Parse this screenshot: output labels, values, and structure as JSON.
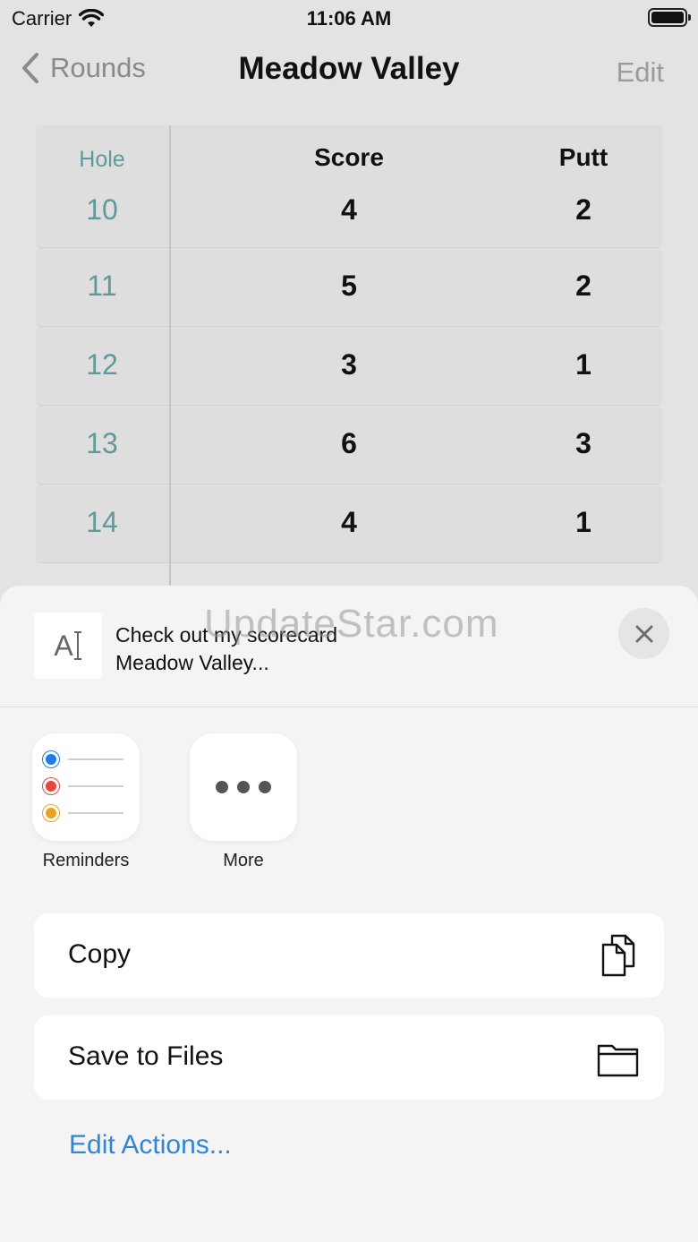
{
  "status_bar": {
    "carrier": "Carrier",
    "time": "11:06 AM"
  },
  "nav": {
    "back_label": "Rounds",
    "title": "Meadow Valley",
    "edit_label": "Edit"
  },
  "table": {
    "headers": {
      "hole": "Hole",
      "score": "Score",
      "putt": "Putt"
    },
    "rows": [
      {
        "hole": "10",
        "score": "4",
        "putt": "2"
      },
      {
        "hole": "11",
        "score": "5",
        "putt": "2"
      },
      {
        "hole": "12",
        "score": "3",
        "putt": "1"
      },
      {
        "hole": "13",
        "score": "6",
        "putt": "3"
      },
      {
        "hole": "14",
        "score": "4",
        "putt": "1"
      }
    ]
  },
  "share_sheet": {
    "preview_glyph": "A",
    "text_line1": "Check out my scorecard",
    "text_line2": "Meadow Valley...",
    "watermark": "UpdateStar.com",
    "apps": [
      {
        "label": "Reminders",
        "icon": "reminders-icon",
        "dot_colors": [
          "#1a7ee6",
          "#e8453c",
          "#f0a020"
        ]
      },
      {
        "label": "More",
        "icon": "more-icon"
      }
    ],
    "actions": [
      {
        "label": "Copy",
        "icon": "copy-icon"
      },
      {
        "label": "Save to Files",
        "icon": "folder-icon"
      }
    ],
    "edit_actions_label": "Edit Actions..."
  },
  "colors": {
    "accent": "#2f86d6",
    "hole_teal": "#5f9a9a"
  }
}
